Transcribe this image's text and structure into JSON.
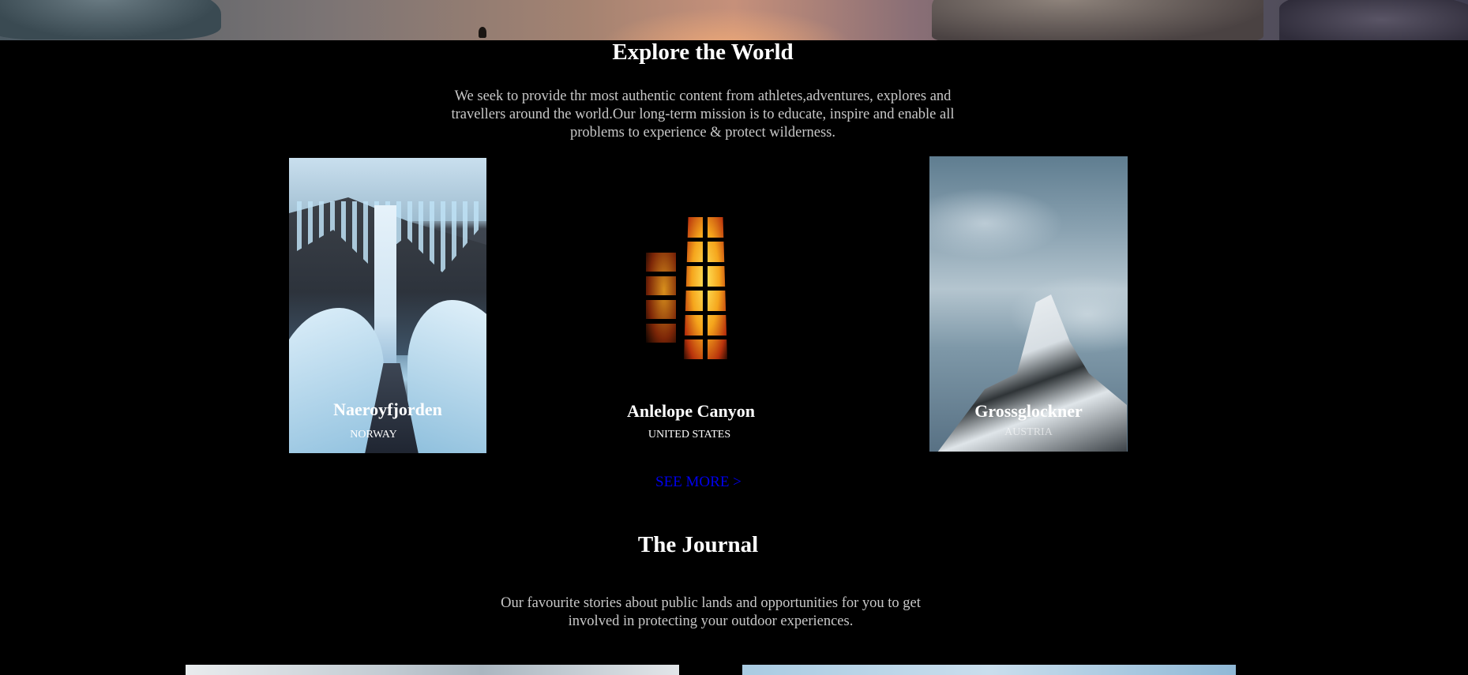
{
  "explore": {
    "title": "Explore the World",
    "text": "We seek to provide thr most authentic content from athletes,adventures, explores and travellers around the world.Our long-term mission is to educate, inspire and enable all problems to experience & protect wilderness."
  },
  "destinations": [
    {
      "name": "Naeroyfjorden",
      "country": "NORWAY",
      "image": "waterfall"
    },
    {
      "name": "Anlelope Canyon",
      "country": "UNITED STATES",
      "image": "canyon-window"
    },
    {
      "name": "Grossglockner",
      "country": "AUSTRIA",
      "image": "snowy-mountain"
    }
  ],
  "see_more": "SEE MORE >",
  "journal": {
    "title": "The Journal",
    "text": "Our favourite stories about public lands and opportunities for you to get involved in protecting your outdoor experiences."
  },
  "colors": {
    "background": "#000000",
    "heading": "#ffffff",
    "body_text": "#c8c8c8",
    "link": "#0000ee"
  }
}
